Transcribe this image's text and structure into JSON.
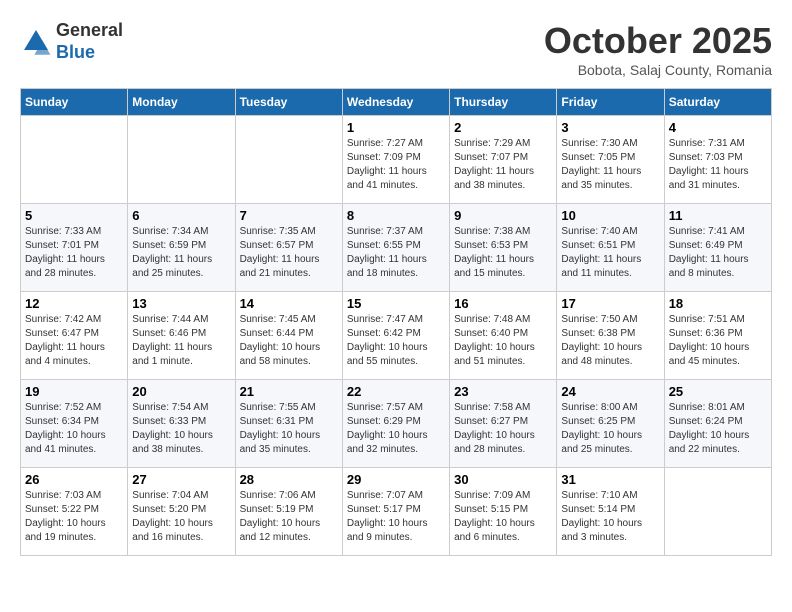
{
  "header": {
    "logo": {
      "general": "General",
      "blue": "Blue"
    },
    "title": "October 2025",
    "subtitle": "Bobota, Salaj County, Romania"
  },
  "weekdays": [
    "Sunday",
    "Monday",
    "Tuesday",
    "Wednesday",
    "Thursday",
    "Friday",
    "Saturday"
  ],
  "weeks": [
    [
      {
        "day": "",
        "info": ""
      },
      {
        "day": "",
        "info": ""
      },
      {
        "day": "",
        "info": ""
      },
      {
        "day": "1",
        "info": "Sunrise: 7:27 AM\nSunset: 7:09 PM\nDaylight: 11 hours and 41 minutes."
      },
      {
        "day": "2",
        "info": "Sunrise: 7:29 AM\nSunset: 7:07 PM\nDaylight: 11 hours and 38 minutes."
      },
      {
        "day": "3",
        "info": "Sunrise: 7:30 AM\nSunset: 7:05 PM\nDaylight: 11 hours and 35 minutes."
      },
      {
        "day": "4",
        "info": "Sunrise: 7:31 AM\nSunset: 7:03 PM\nDaylight: 11 hours and 31 minutes."
      }
    ],
    [
      {
        "day": "5",
        "info": "Sunrise: 7:33 AM\nSunset: 7:01 PM\nDaylight: 11 hours and 28 minutes."
      },
      {
        "day": "6",
        "info": "Sunrise: 7:34 AM\nSunset: 6:59 PM\nDaylight: 11 hours and 25 minutes."
      },
      {
        "day": "7",
        "info": "Sunrise: 7:35 AM\nSunset: 6:57 PM\nDaylight: 11 hours and 21 minutes."
      },
      {
        "day": "8",
        "info": "Sunrise: 7:37 AM\nSunset: 6:55 PM\nDaylight: 11 hours and 18 minutes."
      },
      {
        "day": "9",
        "info": "Sunrise: 7:38 AM\nSunset: 6:53 PM\nDaylight: 11 hours and 15 minutes."
      },
      {
        "day": "10",
        "info": "Sunrise: 7:40 AM\nSunset: 6:51 PM\nDaylight: 11 hours and 11 minutes."
      },
      {
        "day": "11",
        "info": "Sunrise: 7:41 AM\nSunset: 6:49 PM\nDaylight: 11 hours and 8 minutes."
      }
    ],
    [
      {
        "day": "12",
        "info": "Sunrise: 7:42 AM\nSunset: 6:47 PM\nDaylight: 11 hours and 4 minutes."
      },
      {
        "day": "13",
        "info": "Sunrise: 7:44 AM\nSunset: 6:46 PM\nDaylight: 11 hours and 1 minute."
      },
      {
        "day": "14",
        "info": "Sunrise: 7:45 AM\nSunset: 6:44 PM\nDaylight: 10 hours and 58 minutes."
      },
      {
        "day": "15",
        "info": "Sunrise: 7:47 AM\nSunset: 6:42 PM\nDaylight: 10 hours and 55 minutes."
      },
      {
        "day": "16",
        "info": "Sunrise: 7:48 AM\nSunset: 6:40 PM\nDaylight: 10 hours and 51 minutes."
      },
      {
        "day": "17",
        "info": "Sunrise: 7:50 AM\nSunset: 6:38 PM\nDaylight: 10 hours and 48 minutes."
      },
      {
        "day": "18",
        "info": "Sunrise: 7:51 AM\nSunset: 6:36 PM\nDaylight: 10 hours and 45 minutes."
      }
    ],
    [
      {
        "day": "19",
        "info": "Sunrise: 7:52 AM\nSunset: 6:34 PM\nDaylight: 10 hours and 41 minutes."
      },
      {
        "day": "20",
        "info": "Sunrise: 7:54 AM\nSunset: 6:33 PM\nDaylight: 10 hours and 38 minutes."
      },
      {
        "day": "21",
        "info": "Sunrise: 7:55 AM\nSunset: 6:31 PM\nDaylight: 10 hours and 35 minutes."
      },
      {
        "day": "22",
        "info": "Sunrise: 7:57 AM\nSunset: 6:29 PM\nDaylight: 10 hours and 32 minutes."
      },
      {
        "day": "23",
        "info": "Sunrise: 7:58 AM\nSunset: 6:27 PM\nDaylight: 10 hours and 28 minutes."
      },
      {
        "day": "24",
        "info": "Sunrise: 8:00 AM\nSunset: 6:25 PM\nDaylight: 10 hours and 25 minutes."
      },
      {
        "day": "25",
        "info": "Sunrise: 8:01 AM\nSunset: 6:24 PM\nDaylight: 10 hours and 22 minutes."
      }
    ],
    [
      {
        "day": "26",
        "info": "Sunrise: 7:03 AM\nSunset: 5:22 PM\nDaylight: 10 hours and 19 minutes."
      },
      {
        "day": "27",
        "info": "Sunrise: 7:04 AM\nSunset: 5:20 PM\nDaylight: 10 hours and 16 minutes."
      },
      {
        "day": "28",
        "info": "Sunrise: 7:06 AM\nSunset: 5:19 PM\nDaylight: 10 hours and 12 minutes."
      },
      {
        "day": "29",
        "info": "Sunrise: 7:07 AM\nSunset: 5:17 PM\nDaylight: 10 hours and 9 minutes."
      },
      {
        "day": "30",
        "info": "Sunrise: 7:09 AM\nSunset: 5:15 PM\nDaylight: 10 hours and 6 minutes."
      },
      {
        "day": "31",
        "info": "Sunrise: 7:10 AM\nSunset: 5:14 PM\nDaylight: 10 hours and 3 minutes."
      },
      {
        "day": "",
        "info": ""
      }
    ]
  ]
}
